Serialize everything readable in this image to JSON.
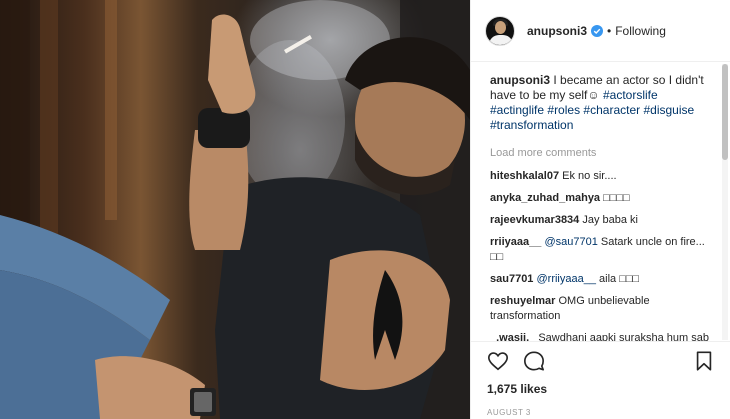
{
  "post": {
    "username": "anupsoni3",
    "follow_status": "Following",
    "separator": "•",
    "caption": {
      "user": "anupsoni3",
      "text": "I became an actor so I didn't have to be my self☺",
      "hashtags": [
        "#actorslife",
        "#actinglife",
        "#roles",
        "#character",
        "#disguise",
        "#transformation"
      ]
    },
    "load_more": "Load more comments",
    "comments": [
      {
        "user": "hiteshkalal07",
        "mention": "",
        "text": "Ek no sir...."
      },
      {
        "user": "anyka_zuhad_mahya",
        "mention": "",
        "text": "□□□□"
      },
      {
        "user": "rajeevkumar3834",
        "mention": "",
        "text": "Jay baba ki"
      },
      {
        "user": "rriiyaaa__",
        "mention": "@sau7701",
        "text": "Satark uncle on fire... □□"
      },
      {
        "user": "sau7701",
        "mention": "@rriiyaaa__",
        "text": "aila □□□"
      },
      {
        "user": "reshuyelmar",
        "mention": "",
        "text": "OMG unbelievable transformation"
      },
      {
        "user": "_.wasii._",
        "mention": "",
        "text": "Sawdhani aapki suraksha hum sab ki"
      }
    ],
    "likes": "1,675 likes",
    "date": "AUGUST 3"
  },
  "icons": {
    "like": "heart-icon",
    "comment": "comment-icon",
    "save": "bookmark-icon",
    "verified": "verified-badge-icon"
  },
  "colors": {
    "link": "#003569",
    "verified": "#3897f0",
    "muted": "#999999"
  }
}
